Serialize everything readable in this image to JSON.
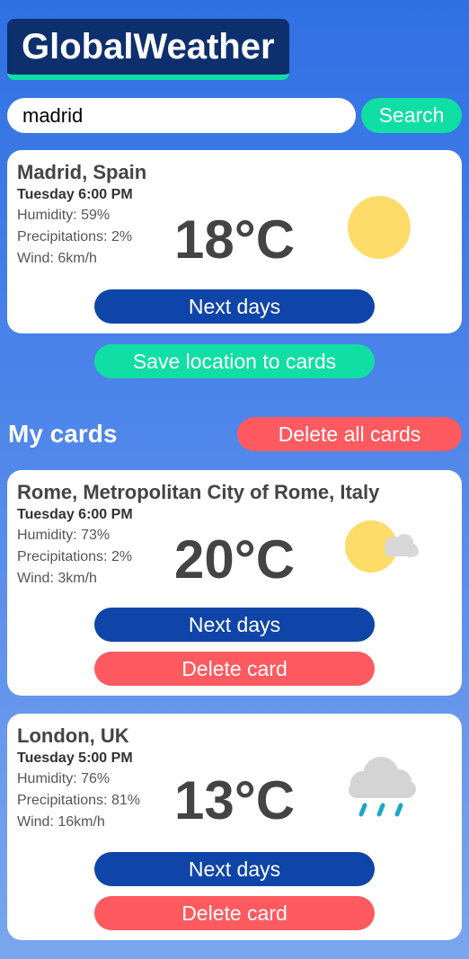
{
  "app": {
    "title": "GlobalWeather"
  },
  "search": {
    "value": "madrid",
    "button_label": "Search"
  },
  "current": {
    "location": "Madrid, Spain",
    "time": "Tuesday 6:00 PM",
    "humidity": "Humidity: 59%",
    "precipitation": "Precipitations: 2%",
    "wind": "Wind: 6km/h",
    "temperature": "18°C",
    "icon": "sun-icon",
    "next_days_label": "Next days"
  },
  "save_label": "Save location to cards",
  "my_cards": {
    "title": "My cards",
    "delete_all_label": "Delete all cards",
    "cards": [
      {
        "location": "Rome, Metropolitan City of Rome, Italy",
        "time": "Tuesday 6:00 PM",
        "humidity": "Humidity: 73%",
        "precipitation": "Precipitations: 2%",
        "wind": "Wind: 3km/h",
        "temperature": "20°C",
        "icon": "partly-cloudy-icon",
        "next_days_label": "Next days",
        "delete_label": "Delete card"
      },
      {
        "location": "London, UK",
        "time": "Tuesday 5:00 PM",
        "humidity": "Humidity: 76%",
        "precipitation": "Precipitations: 81%",
        "wind": "Wind: 16km/h",
        "temperature": "13°C",
        "icon": "rain-cloud-icon",
        "next_days_label": "Next days",
        "delete_label": "Delete card"
      }
    ]
  },
  "colors": {
    "brand_dark": "#0d2f6e",
    "accent_green": "#11dea4",
    "button_blue": "#0f45a8",
    "button_red": "#ff5a5f",
    "sun_yellow": "#fddc6a"
  }
}
